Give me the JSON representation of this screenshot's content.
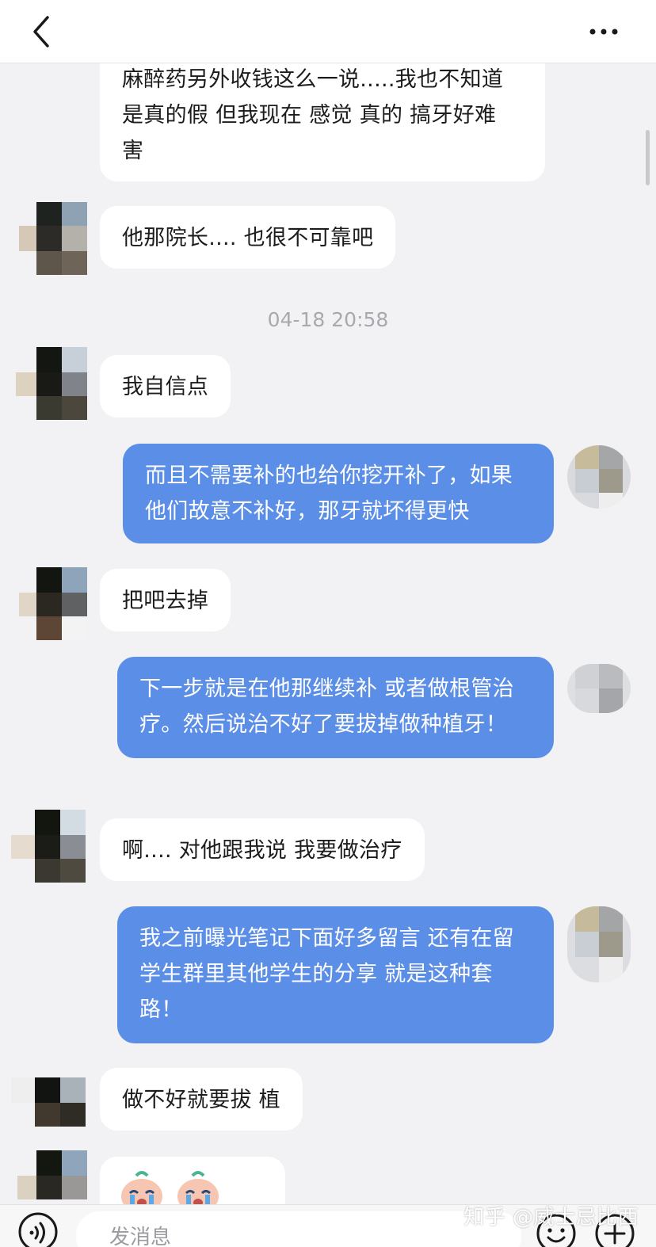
{
  "header": {
    "back_icon": "chevron-left-icon",
    "more_icon": "more-horizontal-icon"
  },
  "messages": [
    {
      "side": "in",
      "text": "麻醉药另外收钱这么一说.....我也不知道是真的假 但我现在 感觉 真的 搞牙好难 害"
    },
    {
      "side": "in",
      "text": "他那院长.... 也很不可靠吧"
    },
    {
      "side": "time",
      "text": "04-18 20:58"
    },
    {
      "side": "in",
      "text": "我自信点"
    },
    {
      "side": "out",
      "text": "而且不需要补的也给你挖开补了，如果他们故意不补好，那牙就坏得更快"
    },
    {
      "side": "in",
      "text": "把吧去掉"
    },
    {
      "side": "out",
      "text": "下一步就是在他那继续补 或者做根管治疗。然后说治不好了要拔掉做种植牙！"
    },
    {
      "side": "in",
      "text": "啊.... 对他跟我说 我要做治疗"
    },
    {
      "side": "out",
      "text": "我之前曝光笔记下面好多留言 还有在留学生群里其他学生的分享 就是这种套路！"
    },
    {
      "side": "in",
      "text": "做不好就要拔 植"
    },
    {
      "side": "in",
      "text": "[crying-emoji][crying-emoji][crying-emoji]"
    }
  ],
  "composer": {
    "placeholder": "发消息",
    "voice_icon": "voice-icon",
    "emoji_icon": "emoji-icon",
    "plus_icon": "plus-icon"
  },
  "watermark": "知乎 @威士忌比西",
  "colors": {
    "background": "#f2f2f4",
    "incoming_bubble": "#ffffff",
    "outgoing_bubble": "#5b8ee6",
    "timestamp": "#a7a9ae"
  }
}
